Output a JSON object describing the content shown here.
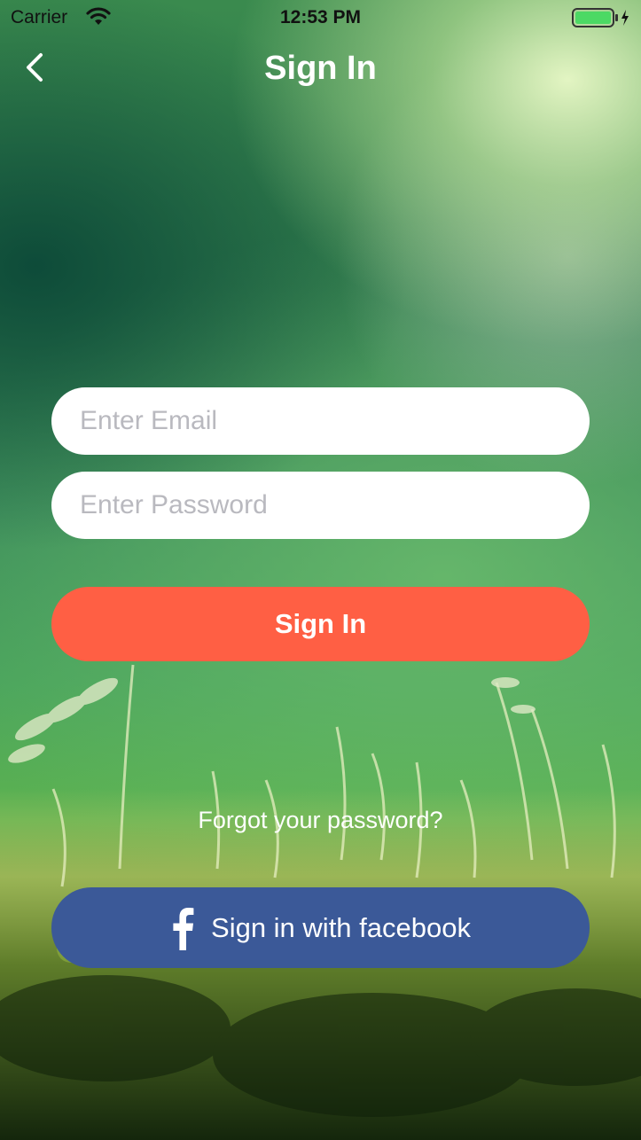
{
  "status_bar": {
    "carrier": "Carrier",
    "time": "12:53 PM",
    "wifi_icon": "wifi-icon",
    "battery_icon": "battery-charging-icon",
    "battery_color": "#4cd964"
  },
  "nav": {
    "title": "Sign In",
    "back_icon": "chevron-left-icon"
  },
  "form": {
    "email_placeholder": "Enter Email",
    "email_value": "",
    "password_placeholder": "Enter Password",
    "password_value": "",
    "signin_label": "Sign In",
    "signin_color": "#ff5f44"
  },
  "forgot_password": "Forgot your password?",
  "facebook": {
    "label": "Sign in with facebook",
    "icon": "facebook-icon",
    "color": "#3b5998"
  }
}
